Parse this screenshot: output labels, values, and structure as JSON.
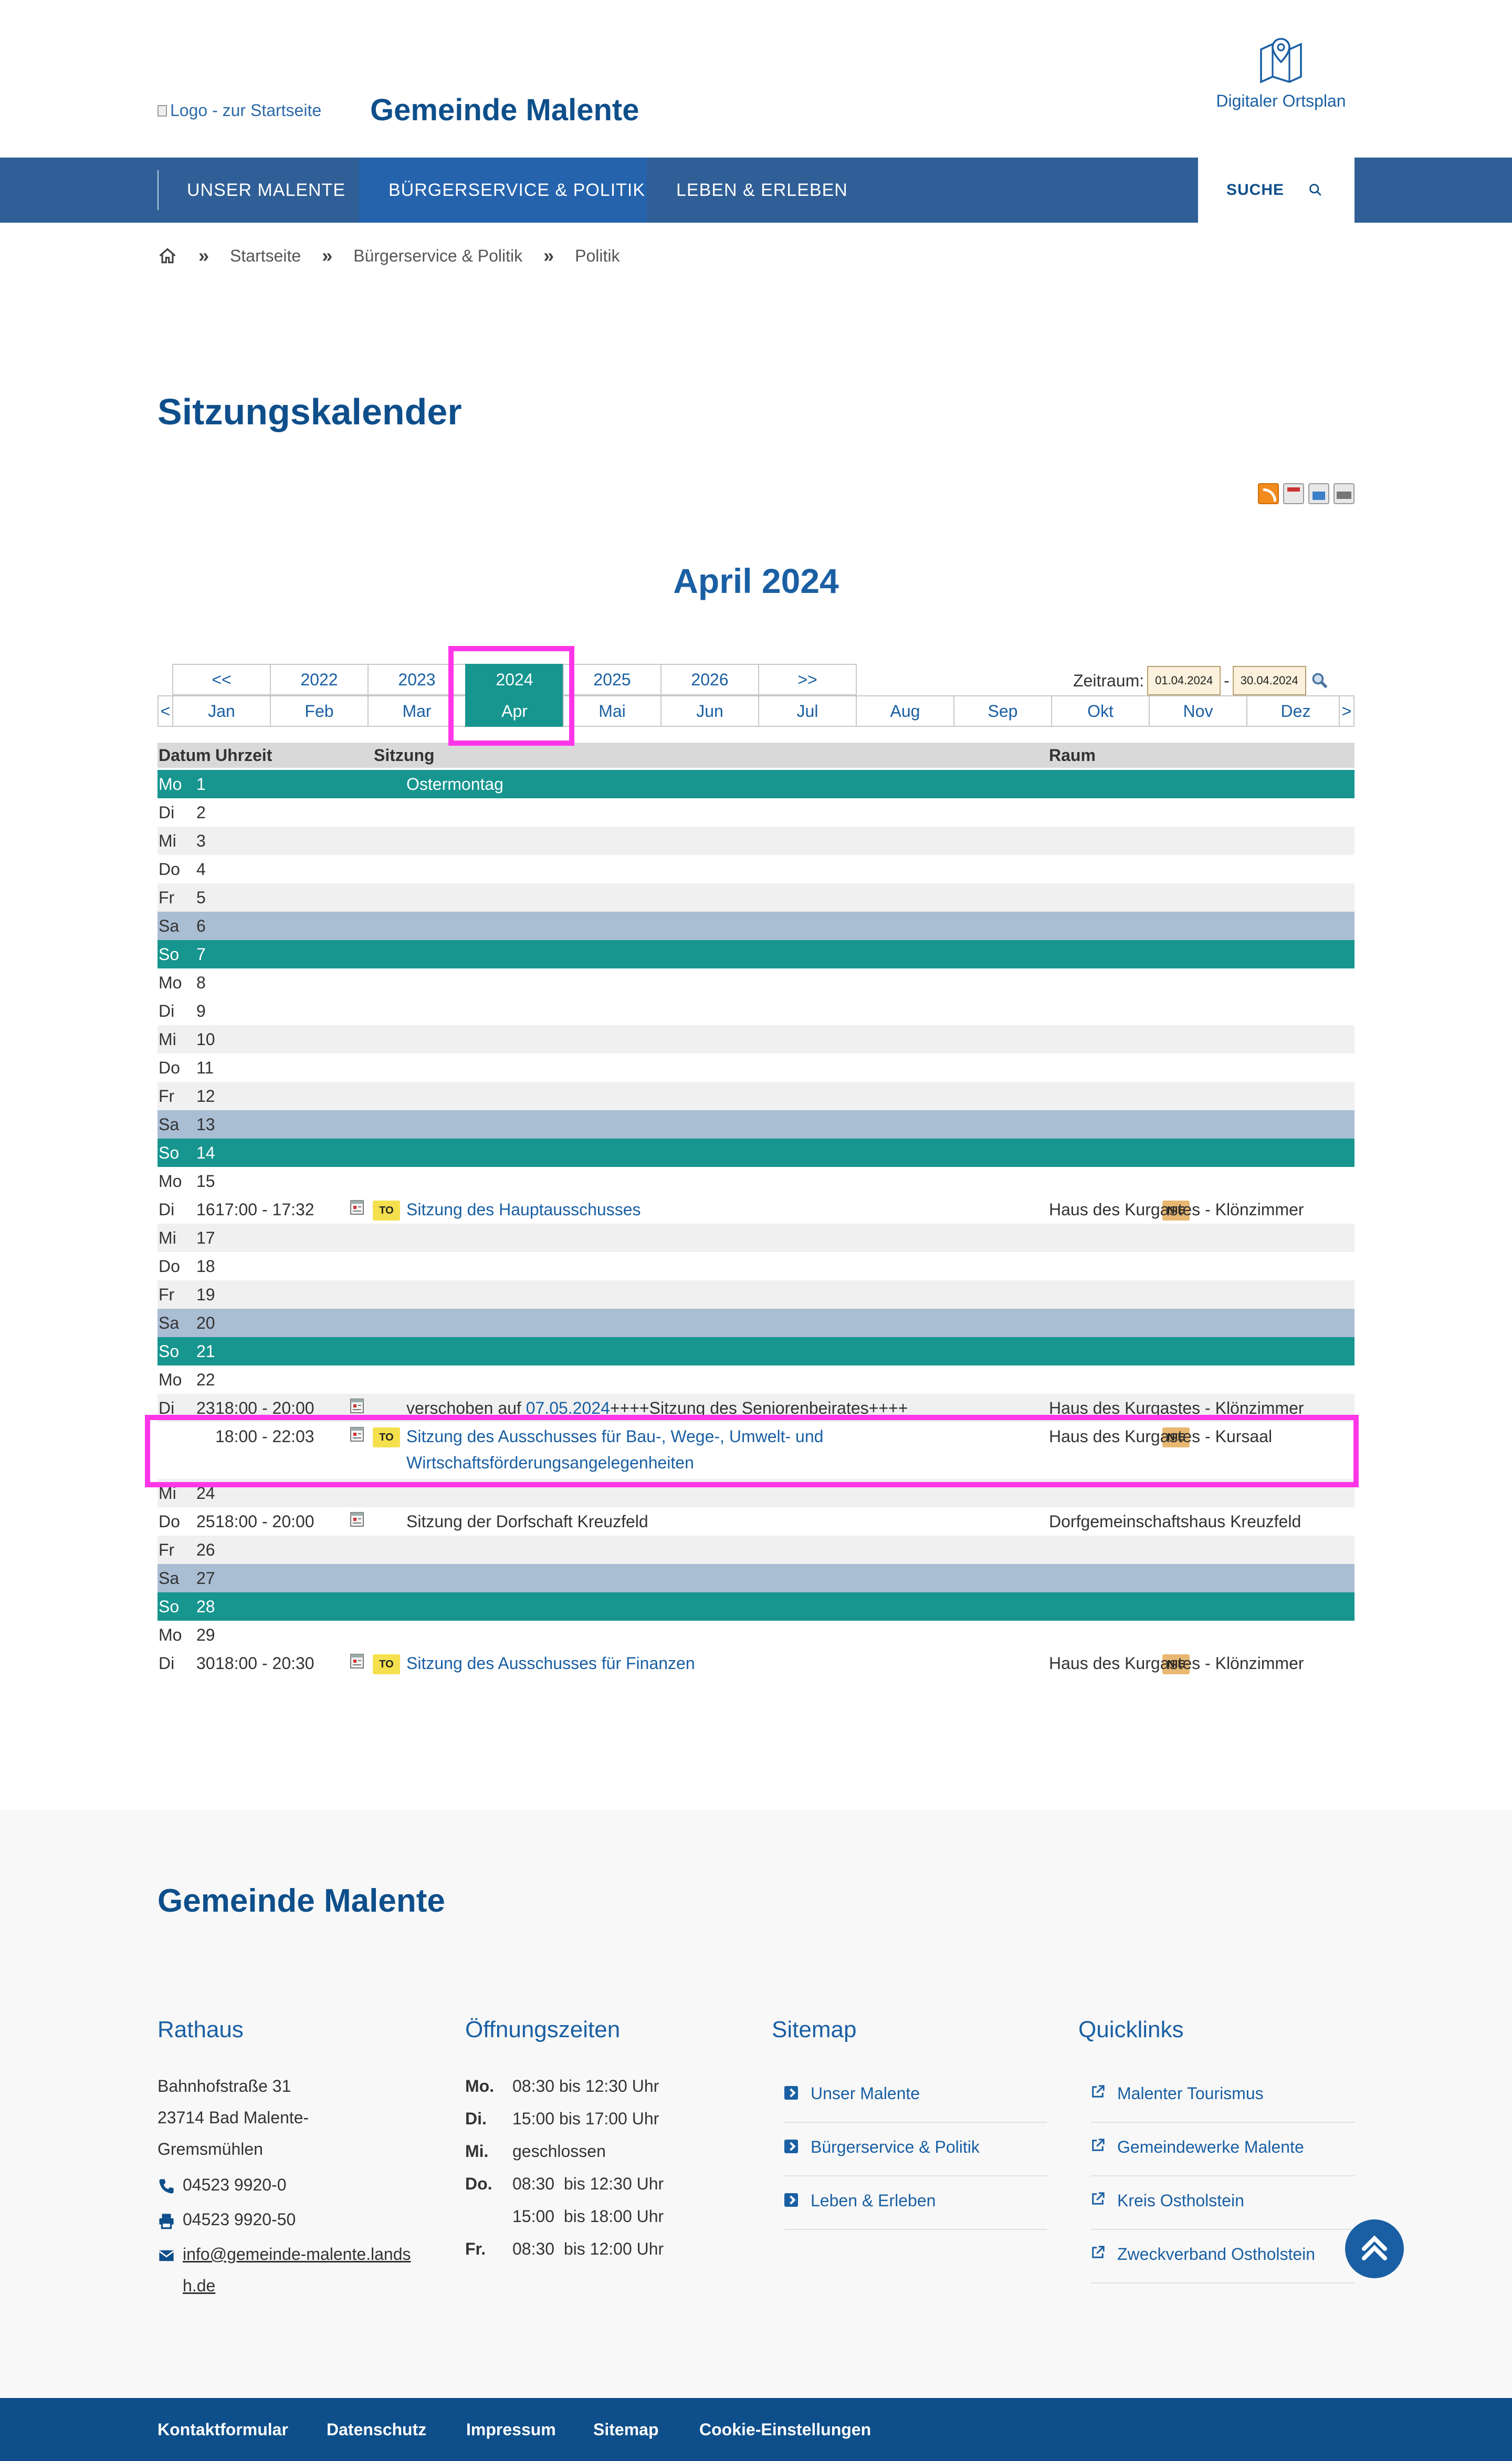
{
  "header": {
    "logo_alt": "Logo - zur Startseite",
    "site_title": "Gemeinde Malente",
    "map_link": "Digitaler Ortsplan"
  },
  "nav": {
    "items": [
      "UNSER MALENTE",
      "BÜRGERSERVICE & POLITIK",
      "LEBEN & ERLEBEN"
    ],
    "active_index": 1,
    "search_label": "SUCHE"
  },
  "breadcrumb": [
    "Startseite",
    "Bürgerservice & Politik",
    "Politik"
  ],
  "page_title": "Sitzungskalender",
  "month_heading": "April 2024",
  "year_nav": [
    "<<",
    "2022",
    "2023",
    "2024",
    "2025",
    "2026",
    ">>"
  ],
  "month_nav": [
    "<",
    "Jan",
    "Feb",
    "Mar",
    "Apr",
    "Mai",
    "Jun",
    "Jul",
    "Aug",
    "Sep",
    "Okt",
    "Nov",
    "Dez",
    ">"
  ],
  "zeitraum": {
    "label": "Zeitraum:",
    "from": "01.04.2024",
    "dash": "-",
    "to": "30.04.2024"
  },
  "table": {
    "headers": {
      "date": "Datum",
      "time": "Uhrzeit",
      "session": "Sitzung",
      "room": "Raum"
    },
    "badge_to": "TO",
    "badge_nie": "NIE",
    "rows": [
      {
        "wd": "Mo",
        "d": "1",
        "type": "sun",
        "session": "Ostermontag"
      },
      {
        "wd": "Di",
        "d": "2",
        "type": "wd"
      },
      {
        "wd": "Mi",
        "d": "3",
        "type": "alt"
      },
      {
        "wd": "Do",
        "d": "4",
        "type": "wd"
      },
      {
        "wd": "Fr",
        "d": "5",
        "type": "alt"
      },
      {
        "wd": "Sa",
        "d": "6",
        "type": "sat"
      },
      {
        "wd": "So",
        "d": "7",
        "type": "sun"
      },
      {
        "wd": "Mo",
        "d": "8",
        "type": "wd"
      },
      {
        "wd": "Di",
        "d": "9",
        "type": "wd"
      },
      {
        "wd": "Mi",
        "d": "10",
        "type": "alt"
      },
      {
        "wd": "Do",
        "d": "11",
        "type": "wd"
      },
      {
        "wd": "Fr",
        "d": "12",
        "type": "alt"
      },
      {
        "wd": "Sa",
        "d": "13",
        "type": "sat"
      },
      {
        "wd": "So",
        "d": "14",
        "type": "sun"
      },
      {
        "wd": "Mo",
        "d": "15",
        "type": "wd"
      },
      {
        "wd": "Di",
        "d": "16",
        "type": "wd",
        "time": "17:00 - 17:32",
        "doc": true,
        "to": true,
        "session": "Sitzung des Hauptausschusses",
        "link": true,
        "nie": true,
        "room": "Haus des Kurgastes - Klönzimmer"
      },
      {
        "wd": "Mi",
        "d": "17",
        "type": "alt"
      },
      {
        "wd": "Do",
        "d": "18",
        "type": "wd"
      },
      {
        "wd": "Fr",
        "d": "19",
        "type": "alt"
      },
      {
        "wd": "Sa",
        "d": "20",
        "type": "sat"
      },
      {
        "wd": "So",
        "d": "21",
        "type": "sun"
      },
      {
        "wd": "Mo",
        "d": "22",
        "type": "wd"
      },
      {
        "wd": "Di",
        "d": "23",
        "type": "alt",
        "time": "18:00 - 20:00",
        "doc": true,
        "session_pre": "verschoben auf ",
        "session_link": "07.05.2024",
        "session_post": "++++Sitzung des Seniorenbeirates++++",
        "room": "Haus des Kurgastes - Klönzimmer"
      },
      {
        "wd": "",
        "d": "",
        "type": "wd",
        "tall": true,
        "time": "18:00 - 22:03",
        "doc": true,
        "to": true,
        "session": "Sitzung des Ausschusses für Bau-, Wege-, Umwelt- und",
        "session2": "Wirtschaftsförderungsangelegenheiten",
        "link": true,
        "nie": true,
        "room": "Haus des Kurgastes - Kursaal"
      },
      {
        "wd": "Mi",
        "d": "24",
        "type": "alt"
      },
      {
        "wd": "Do",
        "d": "25",
        "type": "wd",
        "time": "18:00 - 20:00",
        "doc": true,
        "session": "Sitzung der Dorfschaft Kreuzfeld",
        "room": "Dorfgemeinschaftshaus Kreuzfeld"
      },
      {
        "wd": "Fr",
        "d": "26",
        "type": "alt"
      },
      {
        "wd": "Sa",
        "d": "27",
        "type": "sat"
      },
      {
        "wd": "So",
        "d": "28",
        "type": "sun"
      },
      {
        "wd": "Mo",
        "d": "29",
        "type": "wd"
      },
      {
        "wd": "Di",
        "d": "30",
        "type": "wd",
        "time": "18:00 - 20:30",
        "doc": true,
        "to": true,
        "session": "Sitzung des Ausschusses für Finanzen",
        "link": true,
        "nie": true,
        "room": "Haus des Kurgastes - Klönzimmer"
      }
    ]
  },
  "footer": {
    "title": "Gemeinde Malente",
    "rathaus": {
      "title": "Rathaus",
      "street": "Bahnhofstraße 31",
      "city1": "23714 Bad Malente-",
      "city2": "Gremsmühlen",
      "phone": "04523 9920-0",
      "fax": "04523 9920-50",
      "email1": "info@gemeinde-malente.lands",
      "email2": "h.de"
    },
    "hours": {
      "title": "Öffnungszeiten",
      "rows": [
        {
          "day": "Mo.",
          "text": "08:30 bis 12:30 Uhr"
        },
        {
          "day": "Di.",
          "text": "15:00 bis 17:00 Uhr"
        },
        {
          "day": "Mi.",
          "text": "geschlossen"
        },
        {
          "day": "Do.",
          "text": "08:30  bis 12:30 Uhr"
        },
        {
          "day": "",
          "text": "15:00  bis 18:00 Uhr"
        },
        {
          "day": "Fr.",
          "text": "08:30  bis 12:00 Uhr"
        }
      ]
    },
    "sitemap": {
      "title": "Sitemap",
      "items": [
        "Unser Malente",
        "Bürgerservice & Politik",
        "Leben & Erleben"
      ]
    },
    "quicklinks": {
      "title": "Quicklinks",
      "items": [
        "Malenter Tourismus",
        "Gemeindewerke Malente",
        "Kreis Ostholstein",
        "Zweckverband Ostholstein"
      ]
    },
    "bottom_links": [
      "Kontaktformular",
      "Datenschutz",
      "Impressum",
      "Sitemap",
      "Cookie-Einstellungen"
    ]
  },
  "colors": {
    "brand": "#0e4f8b",
    "nav": "#2f5f96",
    "teal": "#17958f",
    "saturday": "#a9bdd3",
    "highlight": "#ff36e8"
  }
}
